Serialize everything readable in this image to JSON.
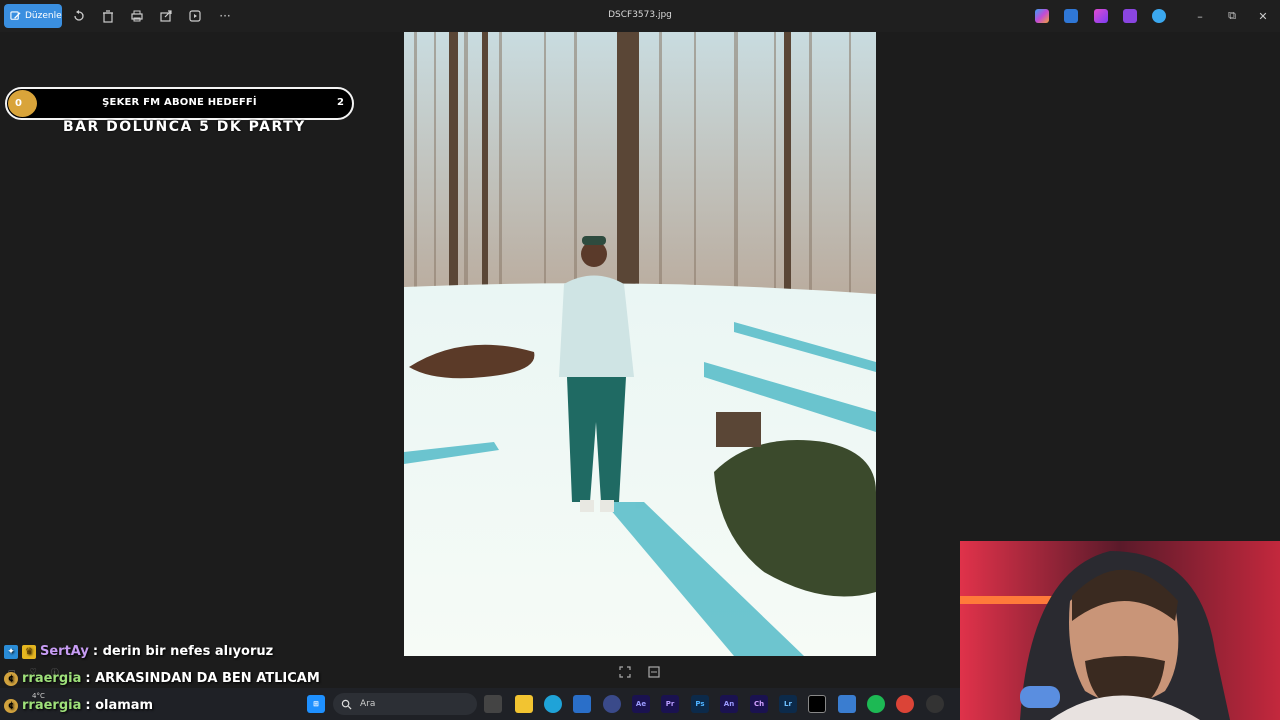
{
  "toolbar": {
    "edit_label": "Düzenle",
    "file_title": "DSCF3573.jpg"
  },
  "goal": {
    "current": "0",
    "title": "ŞEKER FM ABONE HEDEFFİ",
    "target": "2",
    "subtitle": "BAR DOLUNCA 5 DK PARTY"
  },
  "chat": [
    {
      "user": "SertAy",
      "message": ": derin bir nefes alıyoruz"
    },
    {
      "user": "rraergia",
      "message": ": ARKASINDAN DA BEN ATLICAM"
    },
    {
      "user": "rraergia",
      "message": ": olamam"
    }
  ],
  "taskbar": {
    "search_placeholder": "Ara",
    "weather_temp": "4°C"
  },
  "colors": {
    "accent": "#3a8fe0",
    "goal_dot": "#d9a43a"
  }
}
